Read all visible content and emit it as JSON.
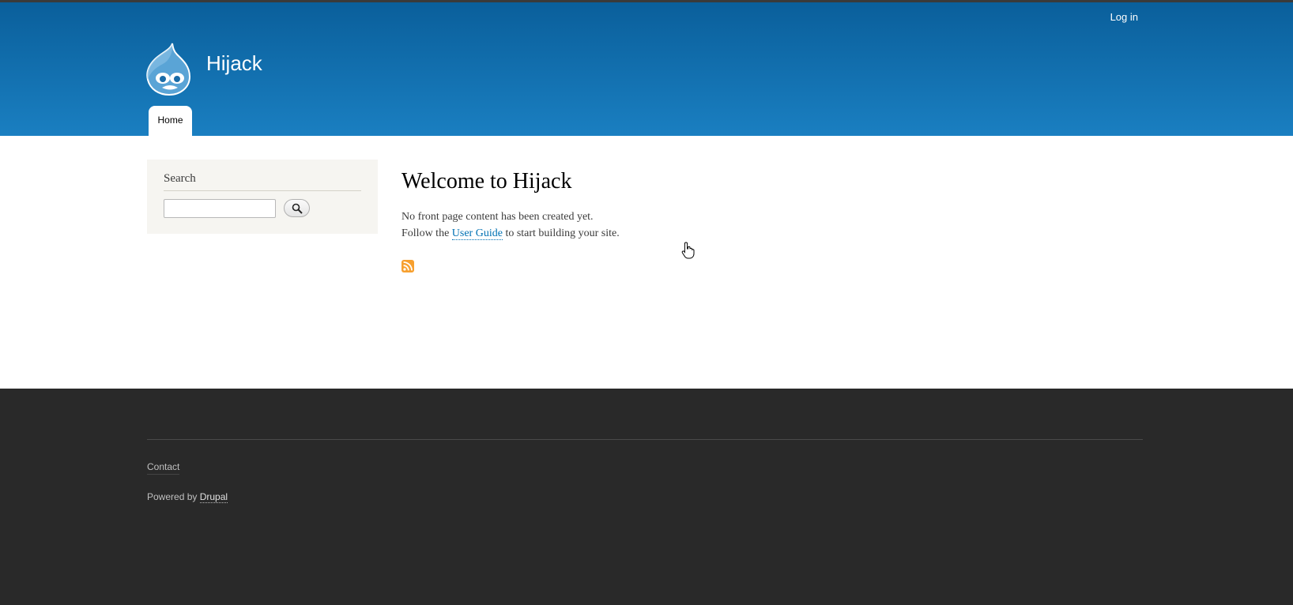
{
  "header": {
    "login_label": "Log in",
    "site_name": "Hijack",
    "nav": {
      "home_label": "Home"
    },
    "gradient": [
      "#0a5f9b",
      "#1a7fc1"
    ]
  },
  "sidebar": {
    "search_block": {
      "title": "Search",
      "input_value": "",
      "button_icon": "search-icon"
    }
  },
  "main": {
    "title": "Welcome to Hijack",
    "line1": "No front page content has been created yet.",
    "line2_before": "Follow the",
    "line2_link": "User Guide",
    "line2_after": "to start building your site.",
    "feed_icon": "rss-feed-icon",
    "link_color": "#0071b3"
  },
  "footer": {
    "contact_label": "Contact",
    "powered_prefix": "Powered by",
    "powered_link": "Drupal",
    "background": "#292929"
  }
}
